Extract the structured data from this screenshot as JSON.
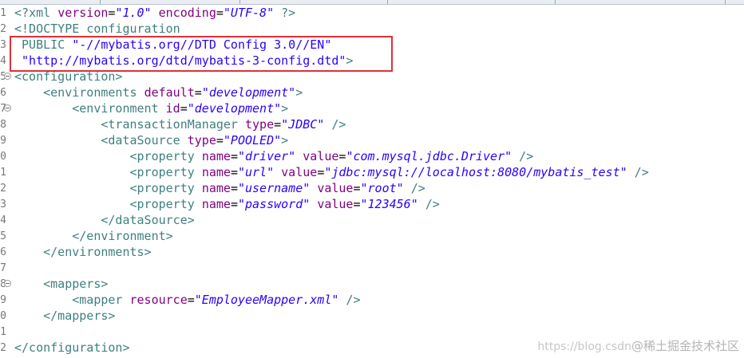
{
  "editor": {
    "gutter": {
      "line_numbers": [
        "1",
        "2",
        "3",
        "4",
        "5",
        "6",
        "7",
        "8",
        "9",
        "0",
        "1",
        "2",
        "3",
        "4",
        "5",
        "6",
        "7",
        "8",
        "9",
        "0",
        "1",
        "2"
      ]
    },
    "lines": {
      "l1": {
        "open": "<?",
        "name": "xml",
        "attr1": "version",
        "val1": "\"1.0\"",
        "attr2": "encoding",
        "val2": "\"UTF-8\"",
        "close": " ?>"
      },
      "l2": {
        "text": "<!DOCTYPE configuration"
      },
      "l3": {
        "keyword": " PUBLIC ",
        "public_id": "\"-//mybatis.org//DTD Config 3.0//EN\""
      },
      "l4": {
        "system_url": " \"http://mybatis.org/dtd/mybatis-3-config.dtd\"",
        "close": ">"
      },
      "l5": {
        "tag": "<configuration>"
      },
      "l6": {
        "open": "<environments",
        "attr": "default",
        "val": "\"development\"",
        "close": ">"
      },
      "l7": {
        "open": "<environment",
        "attr": "id",
        "val": "\"development\"",
        "close": ">"
      },
      "l8": {
        "open": "<transactionManager",
        "attr": "type",
        "val": "\"JDBC\"",
        "close": " />"
      },
      "l9": {
        "open": "<dataSource",
        "attr": "type",
        "val": "\"POOLED\"",
        "close": ">"
      },
      "l10": {
        "open": "<property",
        "attr1": "name",
        "val1": "\"driver\"",
        "attr2": "value",
        "val2": "\"com.mysql.jdbc.Driver\"",
        "close": " />"
      },
      "l11": {
        "open": "<property",
        "attr1": "name",
        "val1": "\"url\"",
        "attr2": "value",
        "val2": "\"jdbc:mysql://localhost:8080/mybatis_test\"",
        "close": " />"
      },
      "l12": {
        "open": "<property",
        "attr1": "name",
        "val1": "\"username\"",
        "attr2": "value",
        "val2": "\"root\"",
        "close": " />"
      },
      "l13": {
        "open": "<property",
        "attr1": "name",
        "val1": "\"password\"",
        "attr2": "value",
        "val2": "\"123456\"",
        "close": " />"
      },
      "l14": {
        "tag": "</dataSource>"
      },
      "l15": {
        "tag": "</environment>"
      },
      "l16": {
        "tag": "</environments>"
      },
      "l18": {
        "tag": "<mappers>"
      },
      "l19": {
        "open": "<mapper",
        "attr": "resource",
        "val": "\"EmployeeMapper.xml\"",
        "close": " />"
      },
      "l20": {
        "tag": "</mappers>"
      },
      "l22": {
        "tag": "</configuration>"
      }
    }
  },
  "watermark": {
    "url": "https://blog.csdn",
    "brand": "@稀土掘金技术社区"
  },
  "colors": {
    "tag": "#3f7f7f",
    "attribute": "#7f007f",
    "value": "#2a00ff",
    "highlight_box": "#e0303a"
  }
}
